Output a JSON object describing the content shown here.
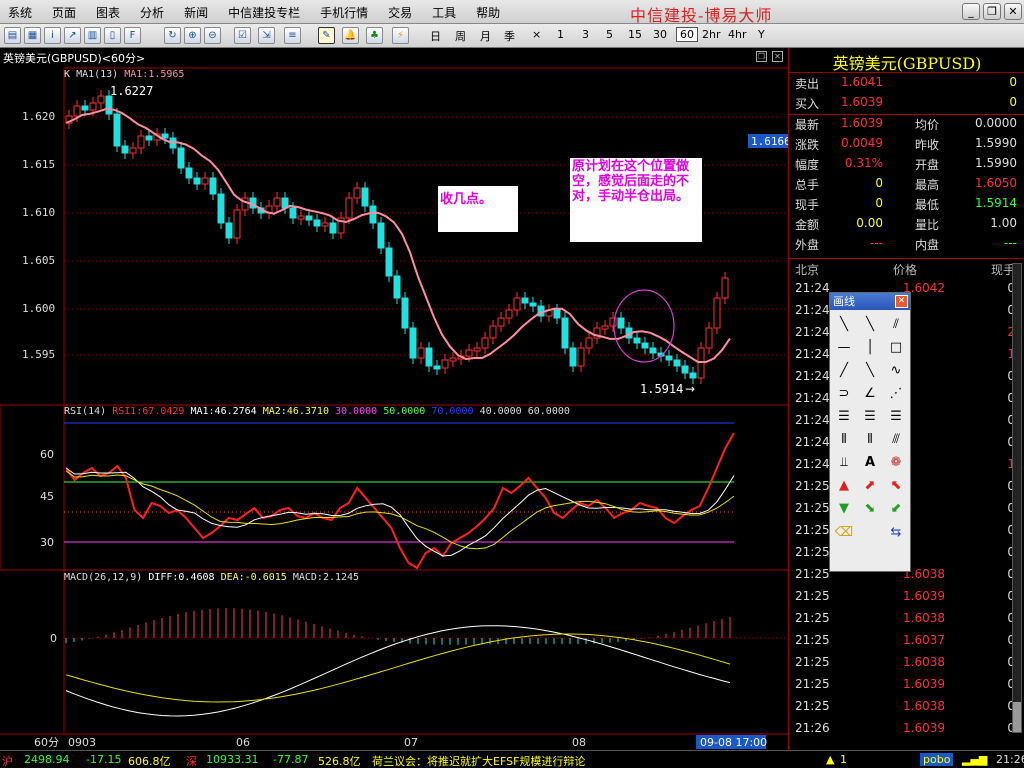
{
  "menu": {
    "items": [
      "系统",
      "页面",
      "图表",
      "分析",
      "新闻",
      "中信建投专栏",
      "手机行情",
      "交易",
      "工具",
      "帮助"
    ],
    "brand": "中信建投-博易大师"
  },
  "toolbar": {
    "periods": [
      "日",
      "周",
      "月",
      "季",
      "×",
      "1",
      "3",
      "5",
      "15",
      "30",
      "60",
      "2hr",
      "4hr",
      "Y"
    ],
    "active_period": "60"
  },
  "chart": {
    "title": "英镑美元(GBPUSD)<60分>",
    "price_legend": {
      "prefix": "K",
      "ma_name": "MA1(13)",
      "ma_value": "MA1:1.5965"
    },
    "price_ticks": [
      "1.620",
      "1.615",
      "1.610",
      "1.605",
      "1.600",
      "1.595"
    ],
    "high_label": "1.6227",
    "low_label": "1.5914",
    "current_price_tag": "1.6166",
    "annotation1": "收几点。",
    "annotation2": "原计划在这个位置做空，感觉后面走的不对，手动半仓出局。",
    "rsi_legend": {
      "name": "RSI(14)",
      "rsi": "RSI1:67.0429",
      "ma1": "MA1:46.2764",
      "ma2": "MA2:46.3710",
      "l30": "30.0000",
      "l50": "50.0000",
      "l70": "70.0000",
      "l40": "40.0000",
      "l60": "60.0000"
    },
    "rsi_ticks": [
      "60",
      "45",
      "30"
    ],
    "macd_legend": {
      "name": "MACD(26,12,9)",
      "diff": "DIFF:0.4608",
      "dea": "DEA:-0.6015",
      "macd": "MACD:2.1245"
    },
    "macd_ticks": [
      "0"
    ],
    "period_label": "60分",
    "x_labels": [
      "0903",
      "06",
      "07",
      "08"
    ],
    "cursor_time": "09-08 17:00"
  },
  "quote": {
    "title": "英镑美元(GBPUSD)",
    "sell_label": "卖出",
    "sell_price": "1.6041",
    "sell_vol": "0",
    "buy_label": "买入",
    "buy_price": "1.6039",
    "buy_vol": "0",
    "rows": [
      {
        "l1": "最新",
        "v1": "1.6039",
        "c1": "#ff3030",
        "l2": "均价",
        "v2": "0.0000",
        "c2": "#ddd"
      },
      {
        "l1": "涨跌",
        "v1": "0.0049",
        "c1": "#ff3030",
        "l2": "昨收",
        "v2": "1.5990",
        "c2": "#ddd"
      },
      {
        "l1": "幅度",
        "v1": "0.31%",
        "c1": "#ff3030",
        "l2": "开盘",
        "v2": "1.5990",
        "c2": "#ddd"
      },
      {
        "l1": "总手",
        "v1": "0",
        "c1": "#ffff00",
        "l2": "最高",
        "v2": "1.6050",
        "c2": "#ff3030"
      },
      {
        "l1": "现手",
        "v1": "0",
        "c1": "#ffff00",
        "l2": "最低",
        "v2": "1.5914",
        "c2": "#30ff30"
      },
      {
        "l1": "金额",
        "v1": "0.00",
        "c1": "#ffff00",
        "l2": "量比",
        "v2": "1.00",
        "c2": "#ddd"
      },
      {
        "l1": "外盘",
        "v1": "---",
        "c1": "#ff3030",
        "l2": "内盘",
        "v2": "---",
        "c2": "#30ff30"
      }
    ],
    "trade_header": {
      "time": "北京",
      "price": "价格",
      "vol": "现手"
    },
    "trades": [
      {
        "t": "21:24",
        "p": "1.6042",
        "v": "0"
      },
      {
        "t": "21:24",
        "p": "",
        "v": "0"
      },
      {
        "t": "21:24",
        "p": "",
        "v": "2"
      },
      {
        "t": "21:24",
        "p": "",
        "v": "1"
      },
      {
        "t": "21:24",
        "p": "",
        "v": "0"
      },
      {
        "t": "21:24",
        "p": "",
        "v": "0"
      },
      {
        "t": "21:24",
        "p": "",
        "v": "0"
      },
      {
        "t": "21:24",
        "p": "",
        "v": "0"
      },
      {
        "t": "21:24",
        "p": "",
        "v": "1"
      },
      {
        "t": "21:25",
        "p": "",
        "v": "0"
      },
      {
        "t": "21:25",
        "p": "",
        "v": "0"
      },
      {
        "t": "21:25",
        "p": "",
        "v": "0"
      },
      {
        "t": "21:25",
        "p": "",
        "v": "0"
      },
      {
        "t": "21:25",
        "p": "1.6038",
        "v": "0"
      },
      {
        "t": "21:25",
        "p": "1.6039",
        "v": "0"
      },
      {
        "t": "21:25",
        "p": "1.6038",
        "v": "0"
      },
      {
        "t": "21:25",
        "p": "1.6037",
        "v": "0"
      },
      {
        "t": "21:25",
        "p": "1.6038",
        "v": "0"
      },
      {
        "t": "21:25",
        "p": "1.6039",
        "v": "0"
      },
      {
        "t": "21:25",
        "p": "1.6038",
        "v": "0"
      },
      {
        "t": "21:26",
        "p": "1.6039",
        "v": "0"
      }
    ]
  },
  "draw_tools": {
    "title": "画线",
    "close": "✕"
  },
  "status": {
    "sh_label": "沪",
    "sh_index": "2498.94",
    "sh_change": "-17.15",
    "sh_amount": "606.8亿",
    "sz_label": "深",
    "sz_index": "10933.31",
    "sz_change": "-77.87",
    "sz_amount": "526.8亿",
    "news": "荷兰议会：将推迟就扩大EFSF规模进行辩论",
    "alert_count": "1",
    "pobo": "pobo",
    "time": "21:26"
  }
}
